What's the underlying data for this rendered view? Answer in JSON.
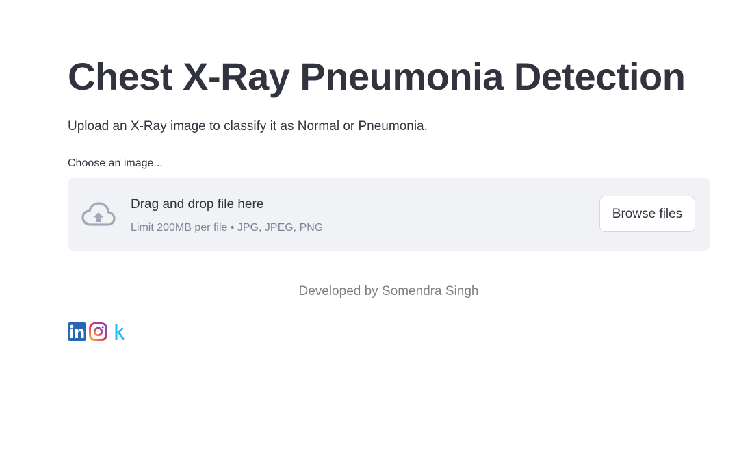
{
  "page": {
    "title": "Chest X-Ray Pneumonia Detection",
    "subtitle": "Upload an X-Ray image to classify it as Normal or Pneumonia."
  },
  "uploader": {
    "label": "Choose an image...",
    "drop_title": "Drag and drop file here",
    "limit_text": "Limit 200MB per file • JPG, JPEG, PNG",
    "browse_label": "Browse files",
    "icon": "cloud-upload-icon"
  },
  "footer": {
    "credit": "Developed by Somendra Singh",
    "socials": [
      {
        "icon": "linkedin-icon",
        "label": "in",
        "color": "#2867b2"
      },
      {
        "icon": "instagram-icon",
        "color": "#d6249f"
      },
      {
        "icon": "kaggle-icon",
        "label": "k",
        "color": "#20beff"
      }
    ]
  },
  "colors": {
    "text": "#31333f",
    "muted": "#808495",
    "dropzone_bg": "#f0f2f6"
  }
}
